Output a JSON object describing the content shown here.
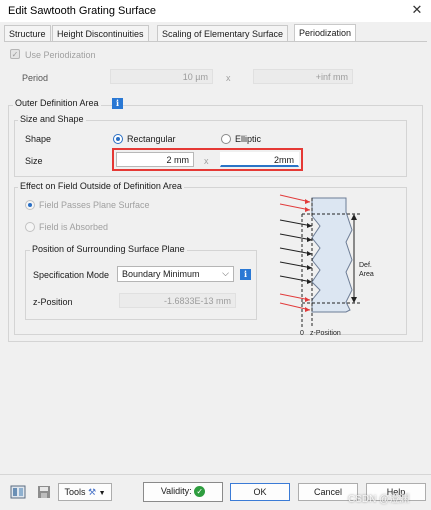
{
  "window": {
    "title": "Edit Sawtooth Grating Surface",
    "close": "✕"
  },
  "tabs": [
    "Structure",
    "Height Discontinuities",
    "Scaling of Elementary Surface",
    "Periodization"
  ],
  "periodization": {
    "use_label": "Use Periodization",
    "period_label": "Period",
    "period_x": "10 µm",
    "times": "x",
    "period_y": "+inf mm"
  },
  "outer": {
    "title": "Outer Definition Area",
    "size_shape_title": "Size and Shape",
    "shape_label": "Shape",
    "rect_label": "Rectangular",
    "elliptic_label": "Elliptic",
    "size_label": "Size",
    "size_x": "2 mm",
    "times": "x",
    "size_y": "2mm"
  },
  "effect": {
    "title": "Effect on Field Outside of Definition Area",
    "passes_label": "Field Passes Plane Surface",
    "absorbed_label": "Field is Absorbed",
    "position_title": "Position of Surrounding Surface Plane",
    "spec_label": "Specification Mode",
    "spec_value": "Boundary Minimum",
    "zpos_label": "z-Position",
    "zpos_value": "-1.6833E-13 mm"
  },
  "diagram": {
    "def_area_1": "Def.",
    "def_area_2": "Area",
    "zero": "0",
    "zpos": "z-Position"
  },
  "footer": {
    "tools_label": "Tools",
    "validity_label": "Validity:",
    "ok_label": "OK",
    "cancel_label": "Cancel",
    "help_label": "Help",
    "watermark": "CSDN @澄渊"
  },
  "colors": {
    "accent": "#2a78d4",
    "highlight": "#e53935",
    "valid": "#2e9d3f"
  }
}
